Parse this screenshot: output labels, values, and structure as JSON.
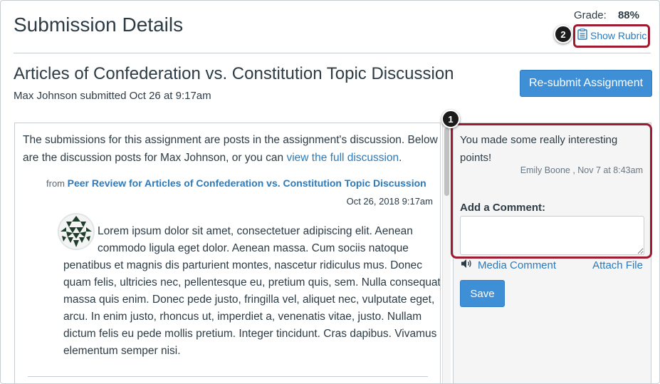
{
  "header": {
    "page_title": "Submission Details",
    "grade_label": "Grade:",
    "grade_value": "88%",
    "rubric_link": "Show Rubric",
    "callout_rubric": "2"
  },
  "assignment": {
    "title": "Articles of Confederation vs. Constitution Topic Discussion",
    "submitted_line": "Max Johnson submitted Oct 26 at 9:17am",
    "resubmit_button": "Re-submit Assignment"
  },
  "content": {
    "intro_text": "The submissions for this assignment are posts in the assignment's discussion. Below are the discussion posts for Max Johnson, or you can ",
    "intro_link": "view the full discussion",
    "intro_end": ".",
    "from_label": "from",
    "from_link": "Peer Review for Articles of Confederation vs. Constitution Topic Discussion",
    "post_date": "Oct 26, 2018 9:17am",
    "post_line1": "Lorem ipsum dolor sit amet, consectetuer adipiscing elit. Aenean",
    "post_line2": "commodo ligula eget dolor. Aenean massa. Cum sociis natoque",
    "post_rest": "penatibus et magnis dis parturient montes, nascetur ridiculus mus. Donec quam felis, ultricies nec, pellentesque eu, pretium quis, sem. Nulla consequat massa quis enim. Donec pede justo, fringilla vel, aliquet nec, vulputate eget, arcu. In enim justo, rhoncus ut, imperdiet a, venenatis vitae, justo. Nullam dictum felis eu pede mollis pretium. Integer tincidunt. Cras dapibus. Vivamus elementum semper nisi."
  },
  "comments": {
    "callout_comments": "1",
    "comment_text": "You made some really interesting points!",
    "comment_meta": "Emily Boone , Nov 7 at 8:43am",
    "add_label": "Add a Comment:",
    "comment_input_value": "",
    "media_comment": "Media Comment",
    "attach_file": "Attach File",
    "save_button": "Save"
  },
  "colors": {
    "accent_blue": "#3f8fd6",
    "link_blue": "#2b7abc",
    "highlight_red": "#9e1b32"
  }
}
